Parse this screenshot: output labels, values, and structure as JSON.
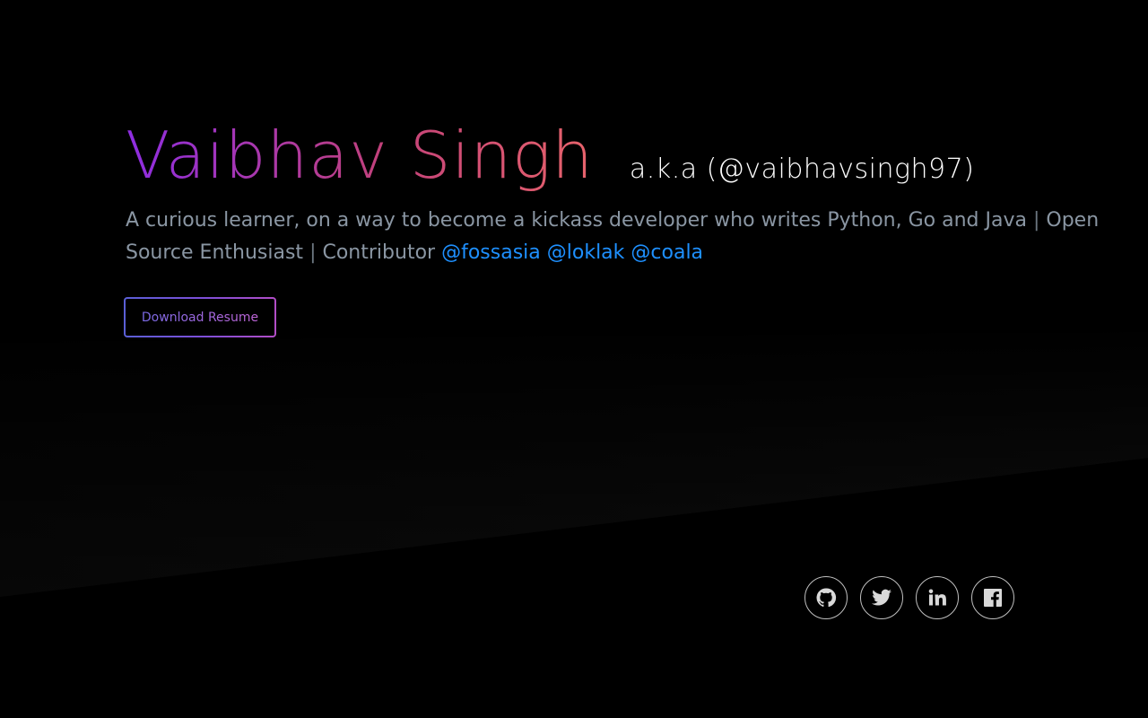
{
  "hero": {
    "name": "Vaibhav Singh",
    "aka": "a.k.a (@vaibhavsingh97)",
    "tagline_part1": "A curious learner, on a way to become a kickass developer who writes Python, Go and Java",
    "separator1": "|",
    "tagline_part2": "Open Source Enthusiast",
    "separator2": "|",
    "tagline_part3": "Contributor",
    "links": [
      {
        "label": "@fossasia"
      },
      {
        "label": "@loklak"
      },
      {
        "label": "@coala"
      }
    ]
  },
  "resume": {
    "label": "Download Resume"
  },
  "social": [
    {
      "icon": "github-icon"
    },
    {
      "icon": "twitter-icon"
    },
    {
      "icon": "linkedin-icon"
    },
    {
      "icon": "facebook-icon"
    }
  ],
  "colors": {
    "background": "#000000",
    "name_gradient_start": "#8e2de2",
    "name_gradient_end": "#e8636b",
    "tagline": "#8a96a3",
    "link": "#1e90ff"
  }
}
